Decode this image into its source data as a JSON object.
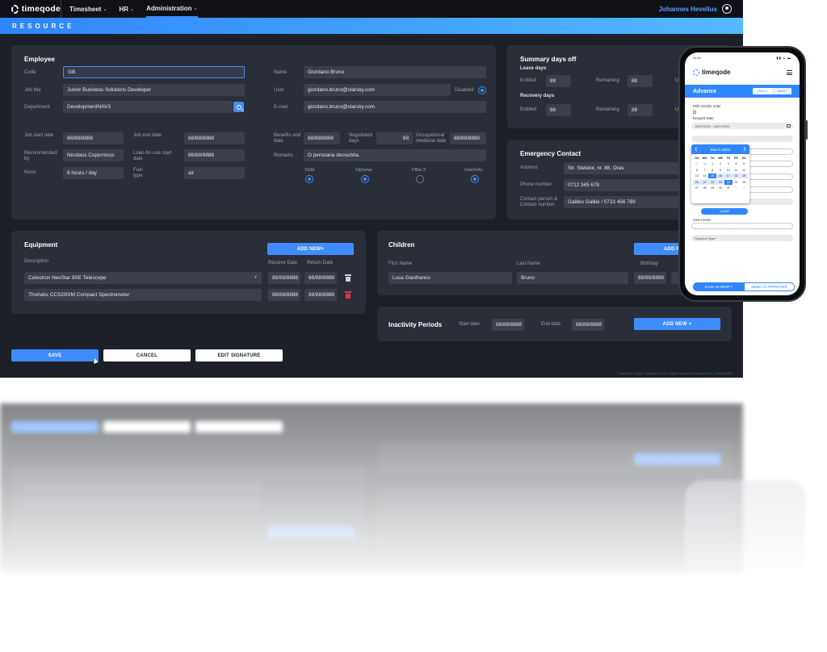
{
  "app": {
    "logo": "timeqode",
    "nav": [
      {
        "label": "Timesheet",
        "has_menu": true
      },
      {
        "label": "HR",
        "has_menu": true
      },
      {
        "label": "Administration",
        "has_menu": true,
        "active": true
      }
    ],
    "user_name": "Johannes Hevelius",
    "banner": "RESOURCE",
    "accent_color": "#3f8cff"
  },
  "employee": {
    "title": "Employee",
    "code": {
      "label": "Code",
      "value": "GB"
    },
    "job_title": {
      "label": "Job title",
      "value": "Junior Business Solutions Developer"
    },
    "department": {
      "label": "Department",
      "value": "DevelopmentNAV3"
    },
    "name": {
      "label": "Name",
      "value": "Giordano Bruno"
    },
    "user": {
      "label": "User",
      "value": "giordano.bruno@starsky.com"
    },
    "disabled_label": "Disabled",
    "email": {
      "label": "E-mail",
      "value": "giordano.bruno@starsky.com"
    },
    "job_start": {
      "label": "Job start date",
      "value": "88/88/8888"
    },
    "job_end": {
      "label": "Job end date",
      "value": "88/88/8888"
    },
    "recommended": {
      "label": "Recommended by",
      "value": "Nicolaus Copernicus"
    },
    "loan_start": {
      "label": "Loan-for-use start date",
      "value": "88/88/8888"
    },
    "norm": {
      "label": "Norm",
      "value": "8 hours / day"
    },
    "fuel": {
      "label": "Fuel type",
      "value": "air"
    },
    "benefits_end": {
      "label": "Benefits end date",
      "value": "88/88/8888"
    },
    "negotiated": {
      "label": "Negotiated days",
      "value": "88"
    },
    "occupational": {
      "label": "Occupational medicine date",
      "value": "88/88/8888"
    },
    "remarks": {
      "label": "Remarks",
      "value": "O persoana deosebita."
    },
    "flags": [
      {
        "label": "SSM",
        "checked": true
      },
      {
        "label": "Diploma",
        "checked": true
      },
      {
        "label": "Pillar 2",
        "checked": false
      },
      {
        "label": "Indefinite",
        "checked": true
      }
    ]
  },
  "summary": {
    "title": "Summary days off",
    "leave_title": "Leave days",
    "recovery_title": "Recovery days",
    "entitled_label": "Entitled",
    "remaining_label": "Remaining",
    "used_label": "U",
    "leave_entitled": "88",
    "leave_remaining": "88",
    "recovery_entitled": "88",
    "recovery_remaining": "88"
  },
  "emergency": {
    "title": "Emergency Contact",
    "address": {
      "label": "Address",
      "value": "Str. Stelelor, nr. 88, Oras"
    },
    "phone": {
      "label": "Phone number",
      "value": "0712 345 678"
    },
    "contact": {
      "label": "Contact person & Contact number",
      "value": "Galileo Galilei / 0723 456 789"
    }
  },
  "equipment": {
    "title": "Equipment",
    "add_label": "ADD NEW+",
    "col_description": "Description",
    "col_receive": "Receive Date",
    "col_return": "Return Date",
    "rows": [
      {
        "description": "Celestron NexStar 8SE Telescope",
        "receive": "88/88/8888",
        "return": "88/88/8888"
      },
      {
        "description": "Thorlabs CCS200/M Compact Spectrometer",
        "receive": "88/88/8888",
        "return": "88/88/8888"
      }
    ]
  },
  "children": {
    "title": "Children",
    "add_label": "ADD N",
    "col_first": "First Name",
    "col_last": "Last Name",
    "col_birthday": "Birthday",
    "first": "Luca Gianfranco",
    "last": "Bruno",
    "birthday": "88/88/8888"
  },
  "inactivity": {
    "title": "Inactivity Periods",
    "start_label": "Start date",
    "start_value": "88/88/8888",
    "end_label": "End date",
    "end_value": "88/88/8888",
    "add_label": "ADD NEW +"
  },
  "actions": {
    "save": "SAVE",
    "cancel": "CANCEL",
    "edit_signature": "EDIT SIGNATURE"
  },
  "footer": "Powered by Vugg® · Copyright © 2022 Vugga Software Development and Consulting SRL",
  "phone": {
    "time": "11:24",
    "status_icons": "▮▮ ▴ ▬",
    "logo": "timeqode",
    "header": "Advance",
    "toggle": [
      "DEPLOI",
      "DRAFT"
    ],
    "with_transfer": "With transfer order",
    "request_date_label": "Request Date",
    "request_date_value": "15/07/2022 - 24/07/2022",
    "calendar_month": "March 2022",
    "dows": [
      "SU",
      "MO",
      "TU",
      "WE",
      "TH",
      "FR",
      "SA"
    ],
    "days": [
      "27",
      "28",
      "1",
      "2",
      "3",
      "4",
      "5",
      "6",
      "7",
      "8",
      "9",
      "10",
      "11",
      "12",
      "13",
      "14",
      "15",
      "16",
      "17",
      "18",
      "19",
      "20",
      "21",
      "22",
      "23",
      "24",
      "25",
      "26",
      "27",
      "28",
      "29",
      "30",
      "31",
      "1",
      "2"
    ],
    "clear": "CLEAR",
    "cost_center": "Cost Center",
    "payment_type": "Payment Type*",
    "save_draft": "SAVE AS DRAFT",
    "send_approver": "SEND TO APPROVER"
  }
}
